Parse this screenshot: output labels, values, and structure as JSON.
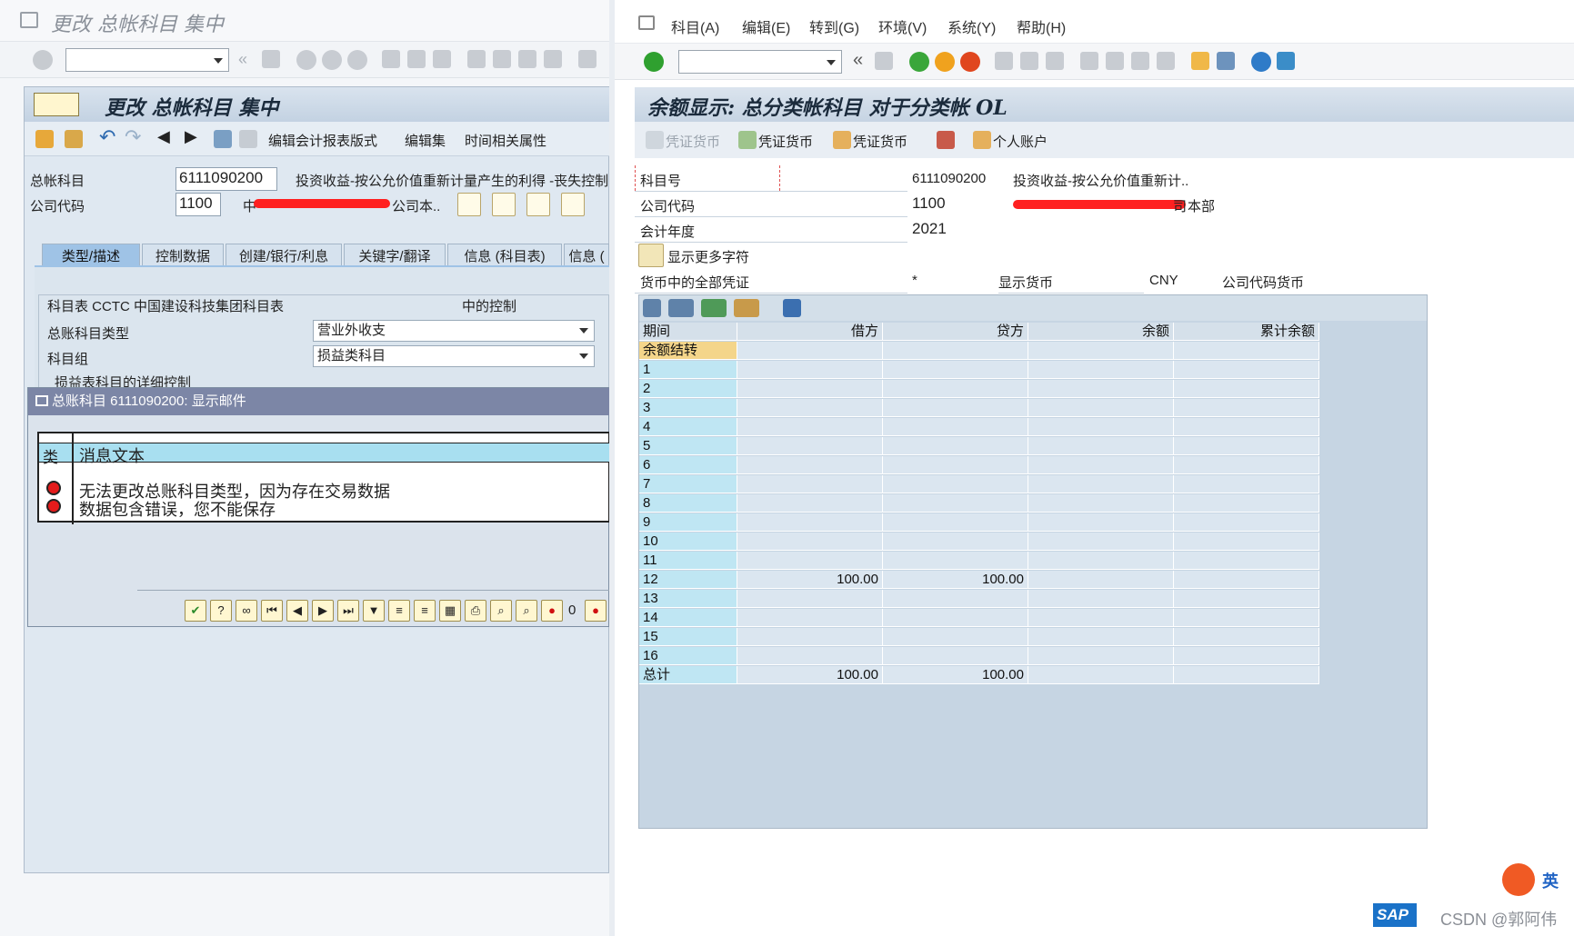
{
  "left": {
    "window_title": "更改 总帐科目 集中",
    "panel_title": "更改 总帐科目 集中",
    "toolbar_links": [
      "编辑会计报表版式",
      "编辑集",
      "时间相关属性"
    ],
    "gl_account_label": "总帐科目",
    "gl_account_value": "6111090200",
    "gl_account_desc": "投资收益-按公允价值重新计量产生的利得 -丧失控制",
    "company_code_label": "公司代码",
    "company_code_value": "1100",
    "company_prefix": "中",
    "company_suffix": "公司本..",
    "tabs": [
      "类型/描述",
      "控制数据",
      "创建/银行/利息",
      "关键字/翻译",
      "信息 (科目表)",
      "信息 ("
    ],
    "coa_label": "科目表 CCTC 中国建设科技集团科目表",
    "coa_right": "中的控制",
    "account_type_label": "总账科目类型",
    "account_type_value": "营业外收支",
    "account_group_label": "科目组",
    "account_group_value": "损益类科目",
    "pl_detail_label": "损益表科目的详细控制"
  },
  "popup": {
    "title": "总账科目 6111090200: 显示邮件",
    "col_type": "类",
    "col_text": "消息文本",
    "messages": [
      "无法更改总账科目类型，因为存在交易数据",
      "数据包含错误，您不能保存"
    ],
    "counter": "0"
  },
  "right": {
    "menu": [
      "科目(A)",
      "编辑(E)",
      "转到(G)",
      "环境(V)",
      "系统(Y)",
      "帮助(H)"
    ],
    "panel_title": "余额显示: 总分类帐科目 对于分类帐 OL",
    "app_buttons": [
      "凭证货币",
      "凭证货币",
      "凭证货币",
      "个人账户"
    ],
    "account_no_label": "科目号",
    "account_no_value": "6111090200",
    "account_desc": "投资收益-按公允价值重新计..",
    "company_code_label": "公司代码",
    "company_code_value": "1100",
    "company_name_suffix": "本部",
    "company_name_mid": "司",
    "fiscal_year_label": "会计年度",
    "fiscal_year_value": "2021",
    "more_chars": "显示更多字符",
    "all_docs_label": "货币中的全部凭证",
    "all_docs_value": "*",
    "display_currency_label": "显示货币",
    "display_currency_value": "CNY",
    "company_currency_label": "公司代码货币"
  },
  "grid": {
    "headers": [
      "期间",
      "借方",
      "贷方",
      "余额",
      "累计余额"
    ],
    "rows": [
      {
        "period": "余额结转",
        "debit": "",
        "credit": "",
        "balance": "",
        "cum": ""
      },
      {
        "period": "1",
        "debit": "",
        "credit": "",
        "balance": "",
        "cum": ""
      },
      {
        "period": "2",
        "debit": "",
        "credit": "",
        "balance": "",
        "cum": ""
      },
      {
        "period": "3",
        "debit": "",
        "credit": "",
        "balance": "",
        "cum": ""
      },
      {
        "period": "4",
        "debit": "",
        "credit": "",
        "balance": "",
        "cum": ""
      },
      {
        "period": "5",
        "debit": "",
        "credit": "",
        "balance": "",
        "cum": ""
      },
      {
        "period": "6",
        "debit": "",
        "credit": "",
        "balance": "",
        "cum": ""
      },
      {
        "period": "7",
        "debit": "",
        "credit": "",
        "balance": "",
        "cum": ""
      },
      {
        "period": "8",
        "debit": "",
        "credit": "",
        "balance": "",
        "cum": ""
      },
      {
        "period": "9",
        "debit": "",
        "credit": "",
        "balance": "",
        "cum": ""
      },
      {
        "period": "10",
        "debit": "",
        "credit": "",
        "balance": "",
        "cum": ""
      },
      {
        "period": "11",
        "debit": "",
        "credit": "",
        "balance": "",
        "cum": ""
      },
      {
        "period": "12",
        "debit": "100.00",
        "credit": "100.00",
        "balance": "",
        "cum": ""
      },
      {
        "period": "13",
        "debit": "",
        "credit": "",
        "balance": "",
        "cum": ""
      },
      {
        "period": "14",
        "debit": "",
        "credit": "",
        "balance": "",
        "cum": ""
      },
      {
        "period": "15",
        "debit": "",
        "credit": "",
        "balance": "",
        "cum": ""
      },
      {
        "period": "16",
        "debit": "",
        "credit": "",
        "balance": "",
        "cum": ""
      },
      {
        "period": "总计",
        "debit": "100.00",
        "credit": "100.00",
        "balance": "",
        "cum": ""
      }
    ]
  },
  "footer": {
    "ime_text": "英",
    "sap_logo": "SAP",
    "watermark": "CSDN @郭阿伟"
  },
  "colors": {
    "accent_blue": "#9fc3e6",
    "period_cyan": "#bfe6f3",
    "led_red": "#e41b1b",
    "ok_green": "#2fa02f"
  }
}
